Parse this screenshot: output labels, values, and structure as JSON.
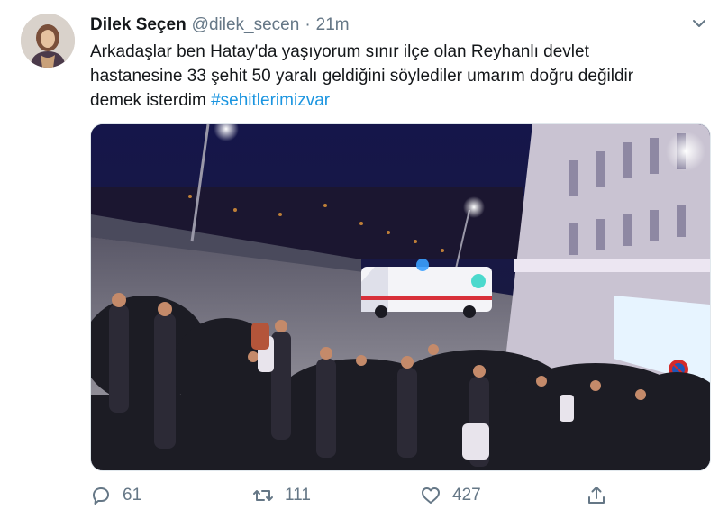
{
  "user": {
    "display_name": "Dilek Seçen",
    "handle": "@dilek_secen",
    "separator": "·",
    "time": "21m"
  },
  "tweet": {
    "lines": [
      "Arkadaşlar ben Hatay'da yaşıyorum sınır ilçe olan Reyhanlı devlet",
      "hastanesine 33 şehit 50 yaralı geldiğini söylediler umarım doğru değildir",
      "demek isterdim"
    ],
    "hashtag": "#sehitlerimizvar"
  },
  "media": {
    "icon": "photo-night-ambulance-crowd"
  },
  "actions": {
    "reply_count": "61",
    "retweet_count": "111",
    "like_count": "427"
  },
  "colors": {
    "text": "#14171a",
    "secondary": "#657786",
    "link": "#1b95e0"
  }
}
